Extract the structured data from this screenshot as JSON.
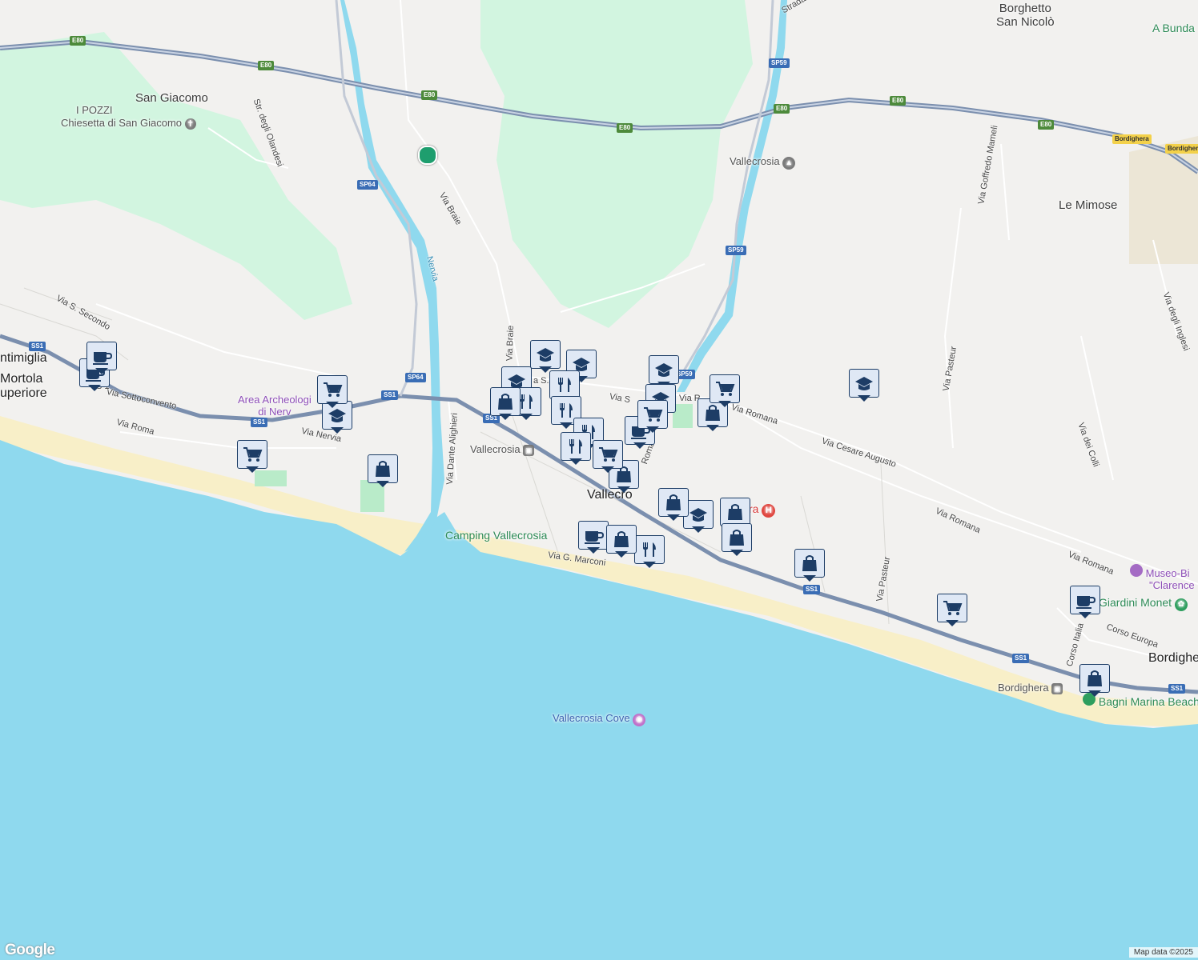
{
  "map": {
    "attribution": "Map data ©2025",
    "logo": "Google",
    "colors": {
      "sea": "#8fd9ee",
      "land": "#f2f1ef",
      "park": "#d2f5e0",
      "motorway": "#7b8fae",
      "river": "#8fd9ee",
      "beach": "#f8efc8"
    },
    "places": {
      "san_giacomo": "San Giacomo",
      "i_pozzi": "I POZZI",
      "chiesetta": "Chiesetta di San Giacomo",
      "borghetto": [
        "Borghetto",
        "San Nicolò"
      ],
      "a_bunda": "A Bunda",
      "vallecrosia_school": "Vallecrosia",
      "le_mimose": "Le Mimose",
      "ventimiglia": "ntimiglia",
      "mortola": [
        "Mortola",
        "uperiore"
      ],
      "area_archeologica": [
        "Area Archeologi",
        "di Nerv"
      ],
      "vallecrosia_station": "Vallecrosia",
      "vallecrosia_town": "Vallecro",
      "camping": "Camping Vallecrosia",
      "vallecrosia_cove": "Vallecrosia Cove",
      "hospital_fragment": "ra",
      "museo": [
        "Museo-Bi",
        "\"Clarence"
      ],
      "giardini": "Giardini Monet",
      "bordighera_town": "Bordighe",
      "bordighera_station": "Bordighera",
      "bagni": "Bagni Marina Beach"
    },
    "streets": {
      "strada": "Strada",
      "str_olandesi": "Str. degli Olandesi",
      "via_braie": "Via Braie",
      "via_braie_2": "Via Braie",
      "nervia": "Nervia",
      "via_s_secondo": "Via S. Secondo",
      "via_sottoconvento": "Via Sottoconvento",
      "via_roma_w": "Via Roma",
      "via_nervia": "Via Nervia",
      "via_dante": "Via Dante Alighieri",
      "via_romana_1": "Via Romana",
      "via_cesare": "Via Cesare Augusto",
      "via_romana_2": "Via Romana",
      "via_romana_3": "Via Romana",
      "via_pasteur_1": "Via Pasteur",
      "via_pasteur_2": "Via Pasteur",
      "via_goffredo": "Via Goffredo Mameli",
      "via_inglesi": "Via degli Inglesi",
      "via_colli": "Via dei Colli",
      "via_marconi": "Via G. Marconi",
      "corso_italia": "Corso Italia",
      "corso_europa": "Corso Europa",
      "ss1_prefix": "S 1",
      "via_s": "Via S",
      "via_r": "Via R",
      "via_sa": "a S...",
      "roma": "Roma"
    },
    "shields": {
      "e80": "E80",
      "sp59": "SP59",
      "sp64": "SP64",
      "ss1": "SS1",
      "bordighera": "Bordighera"
    },
    "markers": [
      {
        "kind": "school"
      },
      {
        "kind": "school"
      },
      {
        "kind": "school"
      },
      {
        "kind": "school"
      },
      {
        "kind": "school"
      },
      {
        "kind": "school"
      },
      {
        "kind": "school"
      },
      {
        "kind": "school"
      },
      {
        "kind": "restaurant"
      },
      {
        "kind": "restaurant"
      },
      {
        "kind": "restaurant"
      },
      {
        "kind": "restaurant"
      },
      {
        "kind": "restaurant"
      },
      {
        "kind": "restaurant"
      },
      {
        "kind": "cafe"
      },
      {
        "kind": "cafe"
      },
      {
        "kind": "cafe"
      },
      {
        "kind": "cafe"
      },
      {
        "kind": "cafe"
      },
      {
        "kind": "shop"
      },
      {
        "kind": "shop"
      },
      {
        "kind": "shop"
      },
      {
        "kind": "shop"
      },
      {
        "kind": "shop"
      },
      {
        "kind": "shop"
      },
      {
        "kind": "shop"
      },
      {
        "kind": "shop"
      },
      {
        "kind": "shop"
      },
      {
        "kind": "shop"
      },
      {
        "kind": "cart"
      },
      {
        "kind": "cart"
      },
      {
        "kind": "cart"
      },
      {
        "kind": "cart"
      },
      {
        "kind": "cart"
      },
      {
        "kind": "cart"
      }
    ]
  }
}
